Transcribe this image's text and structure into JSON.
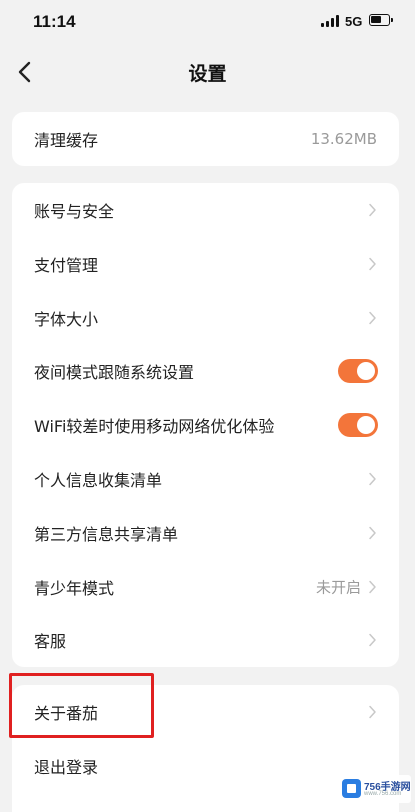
{
  "status_bar": {
    "time": "11:14",
    "network": "5G"
  },
  "nav": {
    "title": "设置"
  },
  "cache_card": {
    "label": "清理缓存",
    "value": "13.62MB"
  },
  "settings": [
    {
      "label": "账号与安全",
      "control": "chevron"
    },
    {
      "label": "支付管理",
      "control": "chevron"
    },
    {
      "label": "字体大小",
      "control": "chevron"
    },
    {
      "label": "夜间模式跟随系统设置",
      "control": "toggle",
      "on": true
    },
    {
      "label": "WiFi较差时使用移动网络优化体验",
      "control": "toggle",
      "on": true
    },
    {
      "label": "个人信息收集清单",
      "control": "chevron"
    },
    {
      "label": "第三方信息共享清单",
      "control": "chevron"
    },
    {
      "label": "青少年模式",
      "control": "chevron",
      "value": "未开启"
    },
    {
      "label": "客服",
      "control": "chevron"
    }
  ],
  "about_card": [
    {
      "label": "关于番茄",
      "control": "chevron"
    },
    {
      "label": "退出登录",
      "control": "none"
    }
  ],
  "watermark": {
    "brand": "756手游网",
    "sub": "www.756.com"
  },
  "colors": {
    "toggle_on": "#f3753a",
    "highlight": "#e02020",
    "background": "#f2f2f2"
  },
  "icons": {
    "back": "chevron-left-icon",
    "row": "chevron-right-icon"
  }
}
